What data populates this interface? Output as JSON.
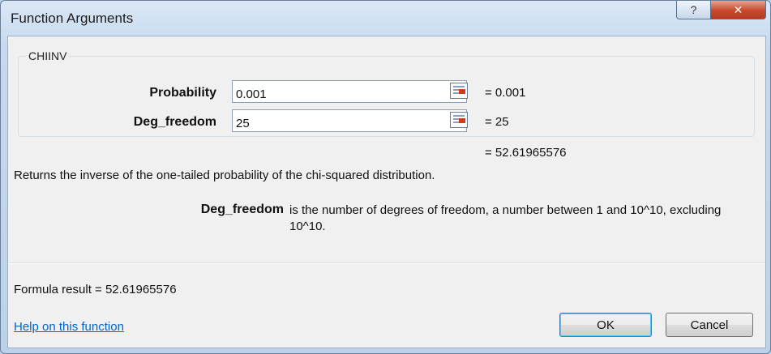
{
  "window": {
    "title": "Function Arguments",
    "help_button": "?",
    "close_button": "✕"
  },
  "function": {
    "name": "CHIINV",
    "arguments": [
      {
        "label": "Probability",
        "value": "0.001",
        "evaluated": "= 0.001"
      },
      {
        "label": "Deg_freedom",
        "value": "25",
        "evaluated": "= 25"
      }
    ],
    "result_preview": "= 52.61965576",
    "description": "Returns the inverse of the one-tailed probability of the chi-squared distribution.",
    "arg_help": {
      "name": "Deg_freedom",
      "text": "is the number of degrees of freedom, a number between 1 and 10^10, excluding 10^10."
    }
  },
  "footer": {
    "formula_result": "Formula result =  52.61965576",
    "help_link": "Help on this function",
    "ok_label": "OK",
    "cancel_label": "Cancel"
  },
  "colors": {
    "frame": "#bcd2eb",
    "client": "#f0f0f0",
    "close_button": "#c8482f",
    "link": "#0066cc",
    "collapse_icon_accent": "#d33a1c"
  },
  "icons": {
    "collapse": "range-collapse-icon",
    "help": "question-mark-icon",
    "close": "close-icon"
  }
}
